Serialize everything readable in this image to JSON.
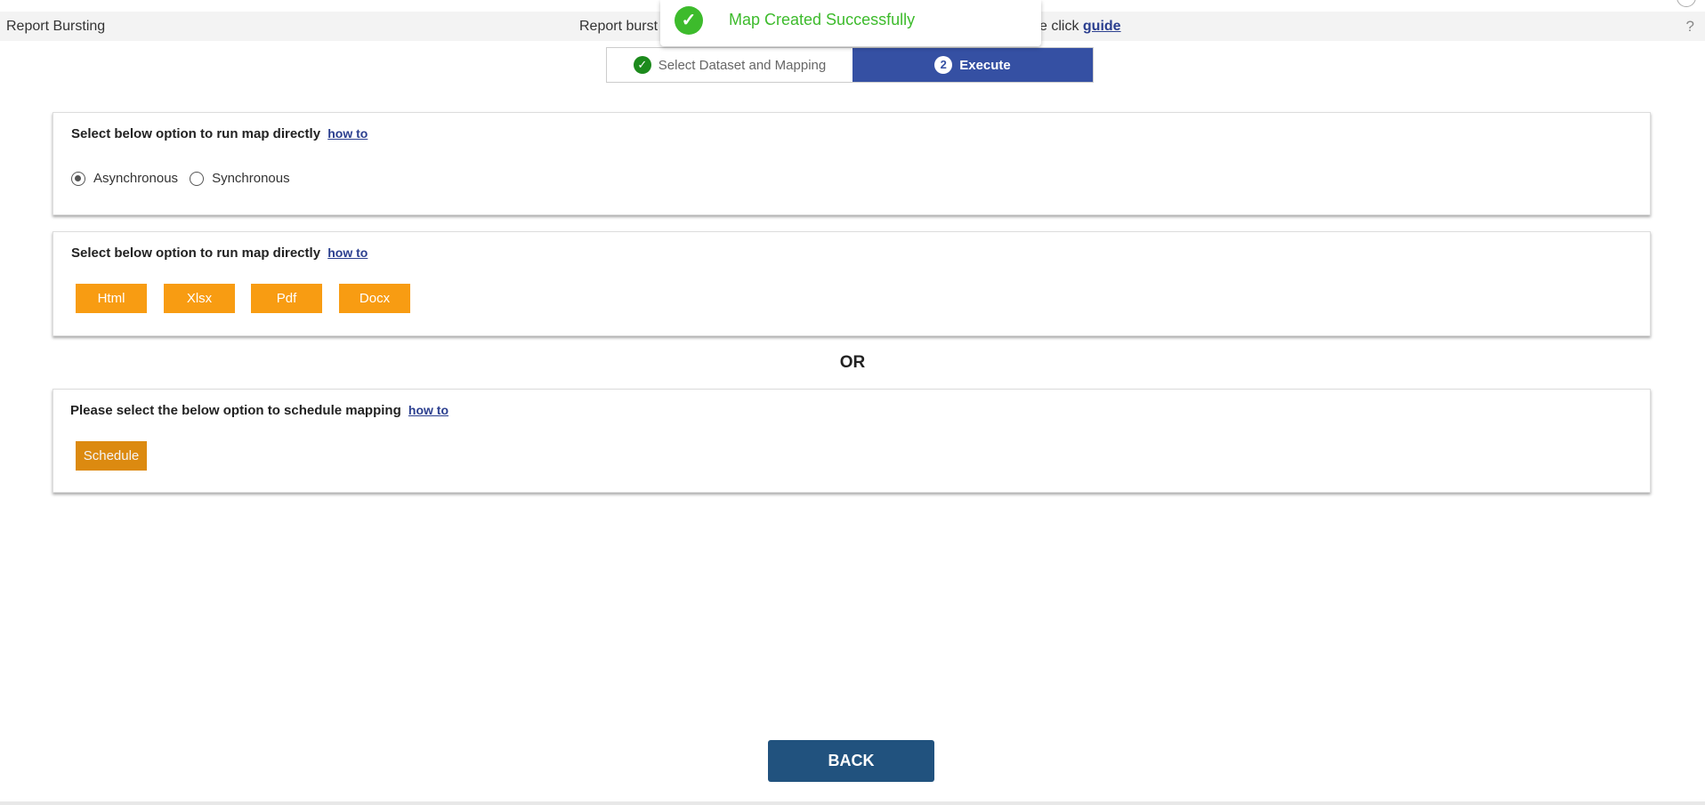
{
  "header": {
    "title": "Report Bursting",
    "center_text_start": "Report burst",
    "center_text_end": "e click",
    "guide_link": "guide",
    "help_icon": "?"
  },
  "toast": {
    "icon": "check-circle-icon",
    "message": "Map Created Successfully",
    "color": "#3dbb2c"
  },
  "stepper": {
    "steps": [
      {
        "label": "Select Dataset and Mapping",
        "badge": "✓",
        "state": "completed"
      },
      {
        "label": "Execute",
        "badge": "2",
        "state": "active"
      }
    ]
  },
  "panel_mode": {
    "heading": "Select below option to run map directly",
    "link": "how to",
    "options": [
      {
        "label": "Asynchronous",
        "selected": true
      },
      {
        "label": "Synchronous",
        "selected": false
      }
    ]
  },
  "panel_formats": {
    "heading": "Select below option to run map directly",
    "link": "how to",
    "buttons": [
      "Html",
      "Xlsx",
      "Pdf",
      "Docx"
    ]
  },
  "or_label": "OR",
  "panel_schedule": {
    "heading": "Please select the below option to schedule mapping",
    "link": "how to",
    "button": "Schedule"
  },
  "back_label": "BACK",
  "colors": {
    "accent_orange": "#f89c12",
    "step_active": "#3550a3",
    "back_button": "#21527e"
  }
}
